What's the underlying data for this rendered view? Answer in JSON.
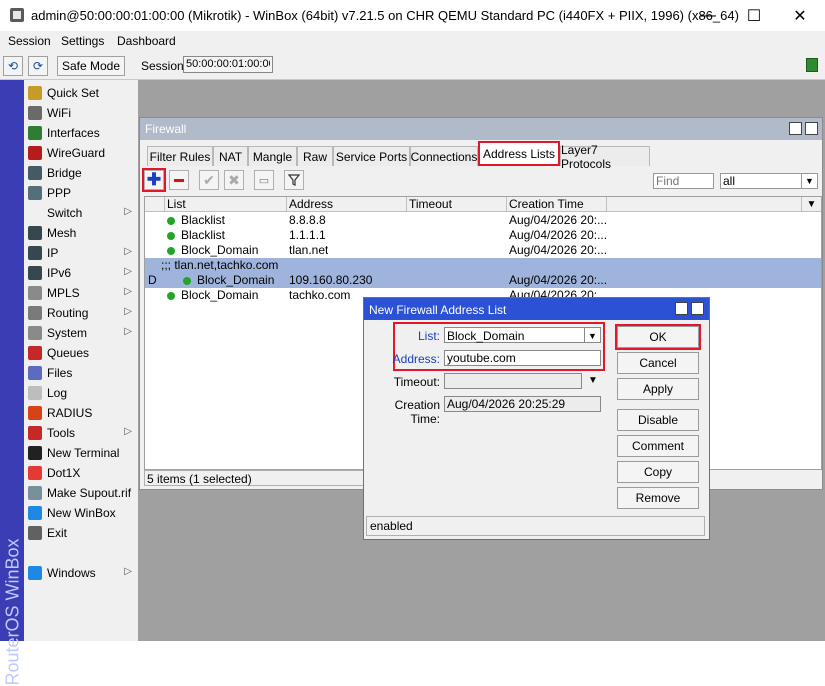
{
  "window": {
    "title": "admin@50:00:00:01:00:00 (Mikrotik) - WinBox (64bit) v7.21.5 on CHR QEMU Standard PC (i440FX + PIIX, 1996) (x86_64)",
    "minimize": "—",
    "maximize": "☐",
    "close": "✕"
  },
  "menu": [
    "Session",
    "Settings",
    "Dashboard"
  ],
  "toolbar": {
    "undo": "⟲",
    "redo": "⟳",
    "safe_mode": "Safe Mode",
    "session_label": "Session:",
    "session_value": "50:00:00:01:00:00"
  },
  "brand": "RouterOS WinBox",
  "sidebar": {
    "items": [
      {
        "label": "Quick Set",
        "icon": "wand-icon",
        "color": "#c89a28",
        "submenu": false
      },
      {
        "label": "WiFi",
        "icon": "wifi-icon",
        "color": "#6a6a6a",
        "submenu": false
      },
      {
        "label": "Interfaces",
        "icon": "interfaces-icon",
        "color": "#2e7d32",
        "submenu": false
      },
      {
        "label": "WireGuard",
        "icon": "wireguard-icon",
        "color": "#b71c1c",
        "submenu": false
      },
      {
        "label": "Bridge",
        "icon": "bridge-icon",
        "color": "#455a64",
        "submenu": false
      },
      {
        "label": "PPP",
        "icon": "ppp-icon",
        "color": "#546e7a",
        "submenu": false
      },
      {
        "label": "Switch",
        "icon": "switch-icon",
        "color": "#f0f0f0",
        "submenu": true
      },
      {
        "label": "Mesh",
        "icon": "mesh-icon",
        "color": "#37474f",
        "submenu": false
      },
      {
        "label": "IP",
        "icon": "ip-icon",
        "color": "#37474f",
        "submenu": true
      },
      {
        "label": "IPv6",
        "icon": "ipv6-icon",
        "color": "#37474f",
        "submenu": true
      },
      {
        "label": "MPLS",
        "icon": "mpls-icon",
        "color": "#8a8a8a",
        "submenu": true
      },
      {
        "label": "Routing",
        "icon": "routing-icon",
        "color": "#7a7a7a",
        "submenu": true
      },
      {
        "label": "System",
        "icon": "gear-icon",
        "color": "#8a8a8a",
        "submenu": true
      },
      {
        "label": "Queues",
        "icon": "queues-icon",
        "color": "#c62828",
        "submenu": false
      },
      {
        "label": "Files",
        "icon": "files-icon",
        "color": "#5c6bc0",
        "submenu": false
      },
      {
        "label": "Log",
        "icon": "log-icon",
        "color": "#bdbdbd",
        "submenu": false
      },
      {
        "label": "RADIUS",
        "icon": "radius-icon",
        "color": "#d84315",
        "submenu": false
      },
      {
        "label": "Tools",
        "icon": "tools-icon",
        "color": "#c62828",
        "submenu": true
      },
      {
        "label": "New Terminal",
        "icon": "terminal-icon",
        "color": "#212121",
        "submenu": false
      },
      {
        "label": "Dot1X",
        "icon": "dot1x-icon",
        "color": "#e53935",
        "submenu": false
      },
      {
        "label": "Make Supout.rif",
        "icon": "supout-icon",
        "color": "#78909c",
        "submenu": false
      },
      {
        "label": "New WinBox",
        "icon": "winbox-icon",
        "color": "#1e88e5",
        "submenu": false
      },
      {
        "label": "Exit",
        "icon": "exit-icon",
        "color": "#616161",
        "submenu": false
      },
      {
        "label": "Windows",
        "icon": "windows-icon",
        "color": "#1e88e5",
        "submenu": true
      }
    ]
  },
  "firewall": {
    "title": "Firewall",
    "tabs": [
      "Filter Rules",
      "NAT",
      "Mangle",
      "Raw",
      "Service Ports",
      "Connections",
      "Address Lists",
      "Layer7 Protocols"
    ],
    "active_tab": "Address Lists",
    "find_placeholder": "Find",
    "filter_value": "all",
    "columns": [
      "List",
      "Address",
      "Timeout",
      "Creation Time"
    ],
    "rows": [
      {
        "flag": "",
        "list": "Blacklist",
        "address": "8.8.8.8",
        "timeout": "",
        "created": "Aug/04/2026 20:..."
      },
      {
        "flag": "",
        "list": "Blacklist",
        "address": "1.1.1.1",
        "timeout": "",
        "created": "Aug/04/2026 20:..."
      },
      {
        "flag": "",
        "list": "Block_Domain",
        "address": "tlan.net",
        "timeout": "",
        "created": "Aug/04/2026 20:..."
      },
      {
        "comment": ";;; tlan.net,tachko.com"
      },
      {
        "flag": "D",
        "list": "Block_Domain",
        "address": "109.160.80.230",
        "timeout": "",
        "created": "Aug/04/2026 20:..."
      },
      {
        "flag": "",
        "list": "Block_Domain",
        "address": "tachko.com",
        "timeout": "",
        "created": "Aug/04/2026 20:..."
      }
    ],
    "status": "5 items (1 selected)"
  },
  "dialog": {
    "title": "New Firewall Address List",
    "list_label": "List:",
    "list_value": "Block_Domain",
    "address_label": "Address:",
    "address_value": "youtube.com",
    "timeout_label": "Timeout:",
    "timeout_value": "",
    "creation_label": "Creation Time:",
    "creation_value": "Aug/04/2026 20:25:29",
    "buttons": [
      "OK",
      "Cancel",
      "Apply",
      "Disable",
      "Comment",
      "Copy",
      "Remove"
    ],
    "status": "enabled"
  },
  "colors": {
    "accent_blue": "#2b52d4",
    "highlight_red": "#e0182a",
    "selected_row": "#9fb4dc",
    "enabled_dot": "#22a52a"
  }
}
